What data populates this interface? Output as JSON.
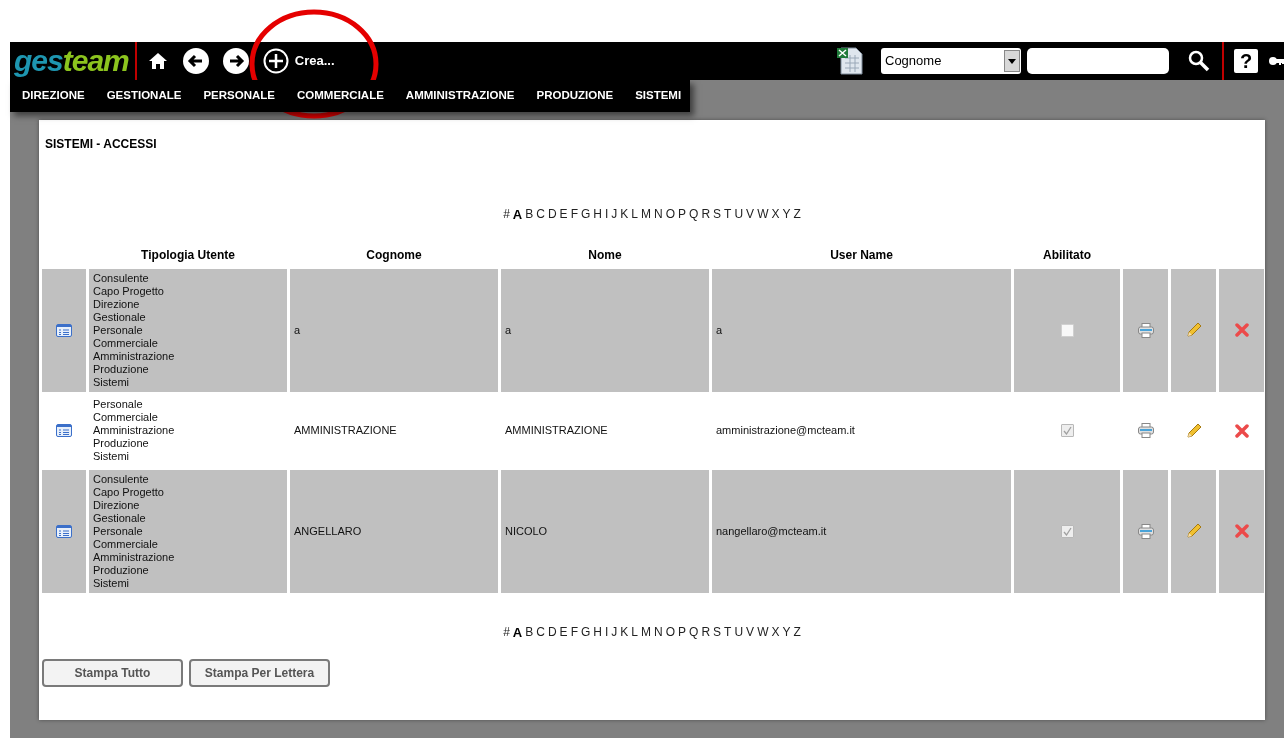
{
  "toolbar": {
    "logo_parts": [
      "ges",
      "team"
    ],
    "create_label": "Crea...",
    "search_by": "Cognome",
    "help_label": "?"
  },
  "menu": [
    "DIREZIONE",
    "GESTIONALE",
    "PERSONALE",
    "COMMERCIALE",
    "AMMINISTRAZIONE",
    "PRODUZIONE",
    "SISTEMI"
  ],
  "page_title": "SISTEMI - ACCESSI",
  "alphabet_top": [
    {
      "letter": "#",
      "selected": false
    },
    {
      "letter": "A",
      "selected": true
    },
    {
      "letter": "B",
      "selected": false
    },
    {
      "letter": "C",
      "selected": false
    },
    {
      "letter": "D",
      "selected": false
    },
    {
      "letter": "E",
      "selected": false
    },
    {
      "letter": "F",
      "selected": false
    },
    {
      "letter": "G",
      "selected": false
    },
    {
      "letter": "H",
      "selected": false
    },
    {
      "letter": "I",
      "selected": false
    },
    {
      "letter": "J",
      "selected": false
    },
    {
      "letter": "K",
      "selected": false
    },
    {
      "letter": "L",
      "selected": false
    },
    {
      "letter": "M",
      "selected": false
    },
    {
      "letter": "N",
      "selected": false
    },
    {
      "letter": "O",
      "selected": false
    },
    {
      "letter": "P",
      "selected": false
    },
    {
      "letter": "Q",
      "selected": false
    },
    {
      "letter": "R",
      "selected": false
    },
    {
      "letter": "S",
      "selected": false
    },
    {
      "letter": "T",
      "selected": false
    },
    {
      "letter": "U",
      "selected": false
    },
    {
      "letter": "V",
      "selected": false
    },
    {
      "letter": "W",
      "selected": false
    },
    {
      "letter": "X",
      "selected": false
    },
    {
      "letter": "Y",
      "selected": false
    },
    {
      "letter": "Z",
      "selected": false
    }
  ],
  "table": {
    "columns": [
      "Tipologia Utente",
      "Cognome",
      "Nome",
      "User Name",
      "Abilitato"
    ],
    "rows": [
      {
        "tipologia": [
          "Consulente",
          "Capo Progetto",
          "Direzione",
          "Gestionale",
          "Personale",
          "Commerciale",
          "Amministrazione",
          "Produzione",
          "Sistemi"
        ],
        "cognome": "a",
        "nome": "a",
        "user_name": "a",
        "abilitato": false,
        "disabled": false
      },
      {
        "tipologia": [
          "Personale",
          "Commerciale",
          "Amministrazione",
          "Produzione",
          "Sistemi"
        ],
        "cognome": "AMMINISTRAZIONE",
        "nome": "AMMINISTRAZIONE",
        "user_name": "amministrazione@mcteam.it",
        "abilitato": true,
        "disabled": true
      },
      {
        "tipologia": [
          "Consulente",
          "Capo Progetto",
          "Direzione",
          "Gestionale",
          "Personale",
          "Commerciale",
          "Amministrazione",
          "Produzione",
          "Sistemi"
        ],
        "cognome": "ANGELLARO",
        "nome": "NICOLO",
        "user_name": "nangellaro@mcteam.it",
        "abilitato": true,
        "disabled": true
      }
    ]
  },
  "alphabet_bottom": [
    {
      "letter": "#",
      "selected": false
    },
    {
      "letter": "A",
      "selected": true
    },
    {
      "letter": "B",
      "selected": false
    },
    {
      "letter": "C",
      "selected": false
    },
    {
      "letter": "D",
      "selected": false
    },
    {
      "letter": "E",
      "selected": false
    },
    {
      "letter": "F",
      "selected": false
    },
    {
      "letter": "G",
      "selected": false
    },
    {
      "letter": "H",
      "selected": false
    },
    {
      "letter": "I",
      "selected": false
    },
    {
      "letter": "J",
      "selected": false
    },
    {
      "letter": "K",
      "selected": false
    },
    {
      "letter": "L",
      "selected": false
    },
    {
      "letter": "M",
      "selected": false
    },
    {
      "letter": "N",
      "selected": false
    },
    {
      "letter": "O",
      "selected": false
    },
    {
      "letter": "P",
      "selected": false
    },
    {
      "letter": "Q",
      "selected": false
    },
    {
      "letter": "R",
      "selected": false
    },
    {
      "letter": "S",
      "selected": false
    },
    {
      "letter": "T",
      "selected": false
    },
    {
      "letter": "U",
      "selected": false
    },
    {
      "letter": "V",
      "selected": false
    },
    {
      "letter": "W",
      "selected": false
    },
    {
      "letter": "X",
      "selected": false
    },
    {
      "letter": "Y",
      "selected": false
    },
    {
      "letter": "Z",
      "selected": false
    }
  ],
  "buttons": [
    "Stampa Tutto",
    "Stampa Per Lettera"
  ]
}
